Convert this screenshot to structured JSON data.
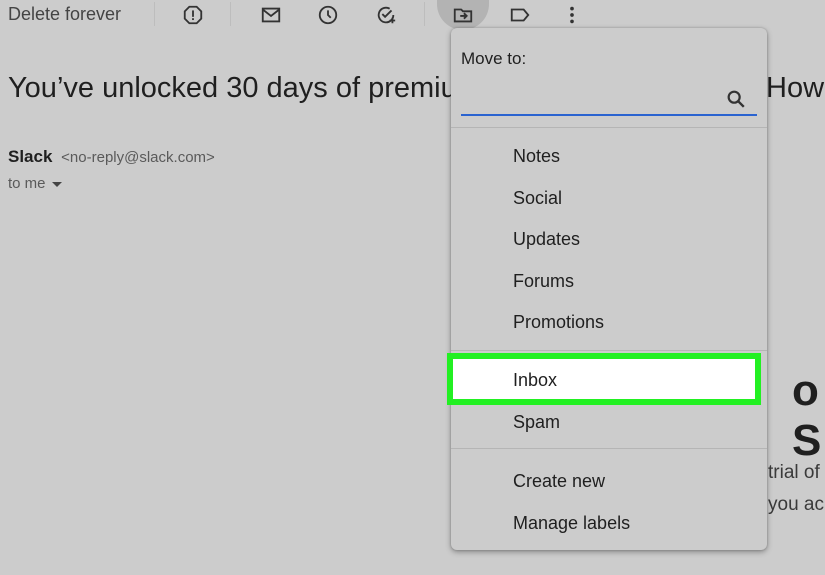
{
  "toolbar": {
    "delete_forever": "Delete forever",
    "icons": [
      "report-spam-icon",
      "mark-unread-icon",
      "snooze-icon",
      "add-to-tasks-icon",
      "move-to-icon",
      "label-icon",
      "more-options-icon"
    ]
  },
  "email": {
    "subject_visible": "You’ve unlocked 30 days of premiu",
    "subject_tail": "How",
    "sender_name": "Slack",
    "sender_email": "<no-reply@slack.com>",
    "to_me": "to me",
    "heading_fragment": "o S",
    "body_line_1": "trial of",
    "body_line_2": "you ac"
  },
  "move_menu": {
    "title": "Move to:",
    "search_placeholder": "",
    "items": [
      "Notes",
      "Social",
      "Updates",
      "Forums",
      "Promotions",
      "Inbox",
      "Spam"
    ],
    "actions": [
      "Create new",
      "Manage labels"
    ],
    "highlighted_item": "Inbox",
    "highlight_color": "#22f022",
    "accent_color": "#2a63d0"
  }
}
